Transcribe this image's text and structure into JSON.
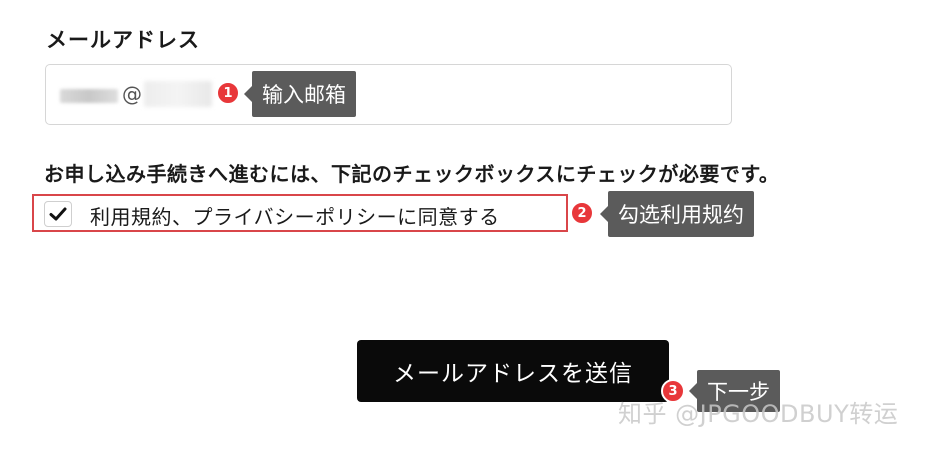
{
  "email_section": {
    "label": "メールアドレス",
    "at_sign": "@"
  },
  "annotations": {
    "step1": {
      "number": "1",
      "tip": "输入邮箱"
    },
    "step2": {
      "number": "2",
      "tip": "勾选利用规约"
    },
    "step3": {
      "number": "3",
      "tip": "下一步"
    }
  },
  "consent": {
    "instruction": "お申し込み手続きへ進むには、下記のチェックボックスにチェックが必要です。",
    "checkbox_label": "利用規約、プライバシーポリシーに同意する",
    "checked": true
  },
  "submit": {
    "label": "メールアドレスを送信"
  },
  "watermark": {
    "text": "知乎 @JPGOODBUY转运"
  },
  "colors": {
    "badge": "#e8373a",
    "tooltip": "#5b5b5b",
    "highlight_border": "#d9464a",
    "button": "#0a0a0a"
  }
}
